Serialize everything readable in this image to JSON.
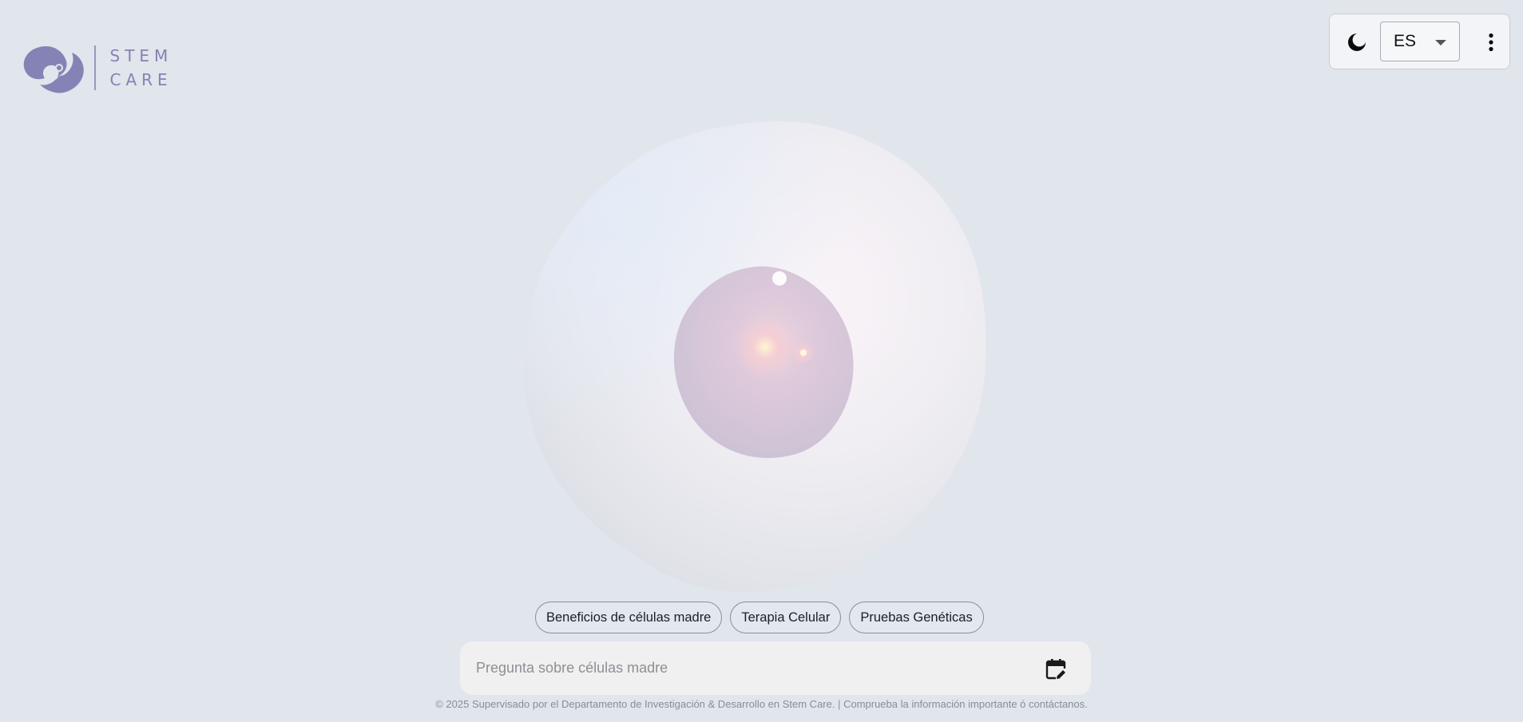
{
  "brand": {
    "line1": "STEM",
    "line2": "CARE",
    "color": "#8582b6"
  },
  "controls": {
    "theme_icon": "moon-icon",
    "language": {
      "selected": "ES"
    },
    "menu_icon": "more-vertical-icon"
  },
  "suggestions": [
    {
      "label": "Beneficios de células madre"
    },
    {
      "label": "Terapia Celular"
    },
    {
      "label": "Pruebas Genéticas"
    }
  ],
  "chat": {
    "placeholder": "Pregunta sobre células madre",
    "action_icon": "calendar-edit-icon"
  },
  "footer": {
    "text": "© 2025 Supervisado por el Departamento de Investigación & Desarrollo en Stem Care. | Comprueba la información importante ó contáctanos."
  },
  "colors": {
    "background": "#e1e5ec",
    "accent": "#8582b6"
  }
}
